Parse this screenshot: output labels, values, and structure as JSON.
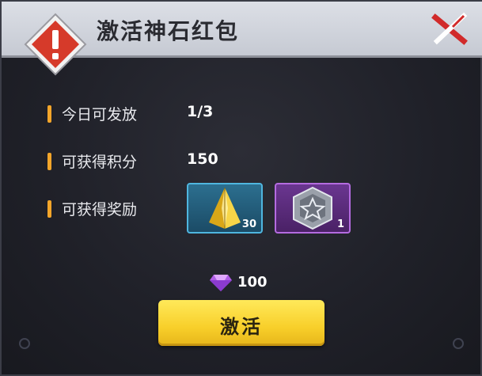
{
  "dialog": {
    "title": "激活神石红包",
    "rows": [
      {
        "label": "今日可发放",
        "value": "1/3"
      },
      {
        "label": "可获得积分",
        "value": "150"
      },
      {
        "label": "可获得奖励",
        "value": ""
      }
    ],
    "rewards": [
      {
        "icon": "golden-pyramid-icon",
        "count": "30"
      },
      {
        "icon": "silver-star-badge-icon",
        "count": "1"
      }
    ],
    "cost": {
      "icon": "purple-diamond-icon",
      "amount": "100"
    },
    "activate_label": "激活"
  },
  "colors": {
    "accent": "#f3a52a",
    "button": "#f8cf2a",
    "warning": "#d63a2a"
  }
}
